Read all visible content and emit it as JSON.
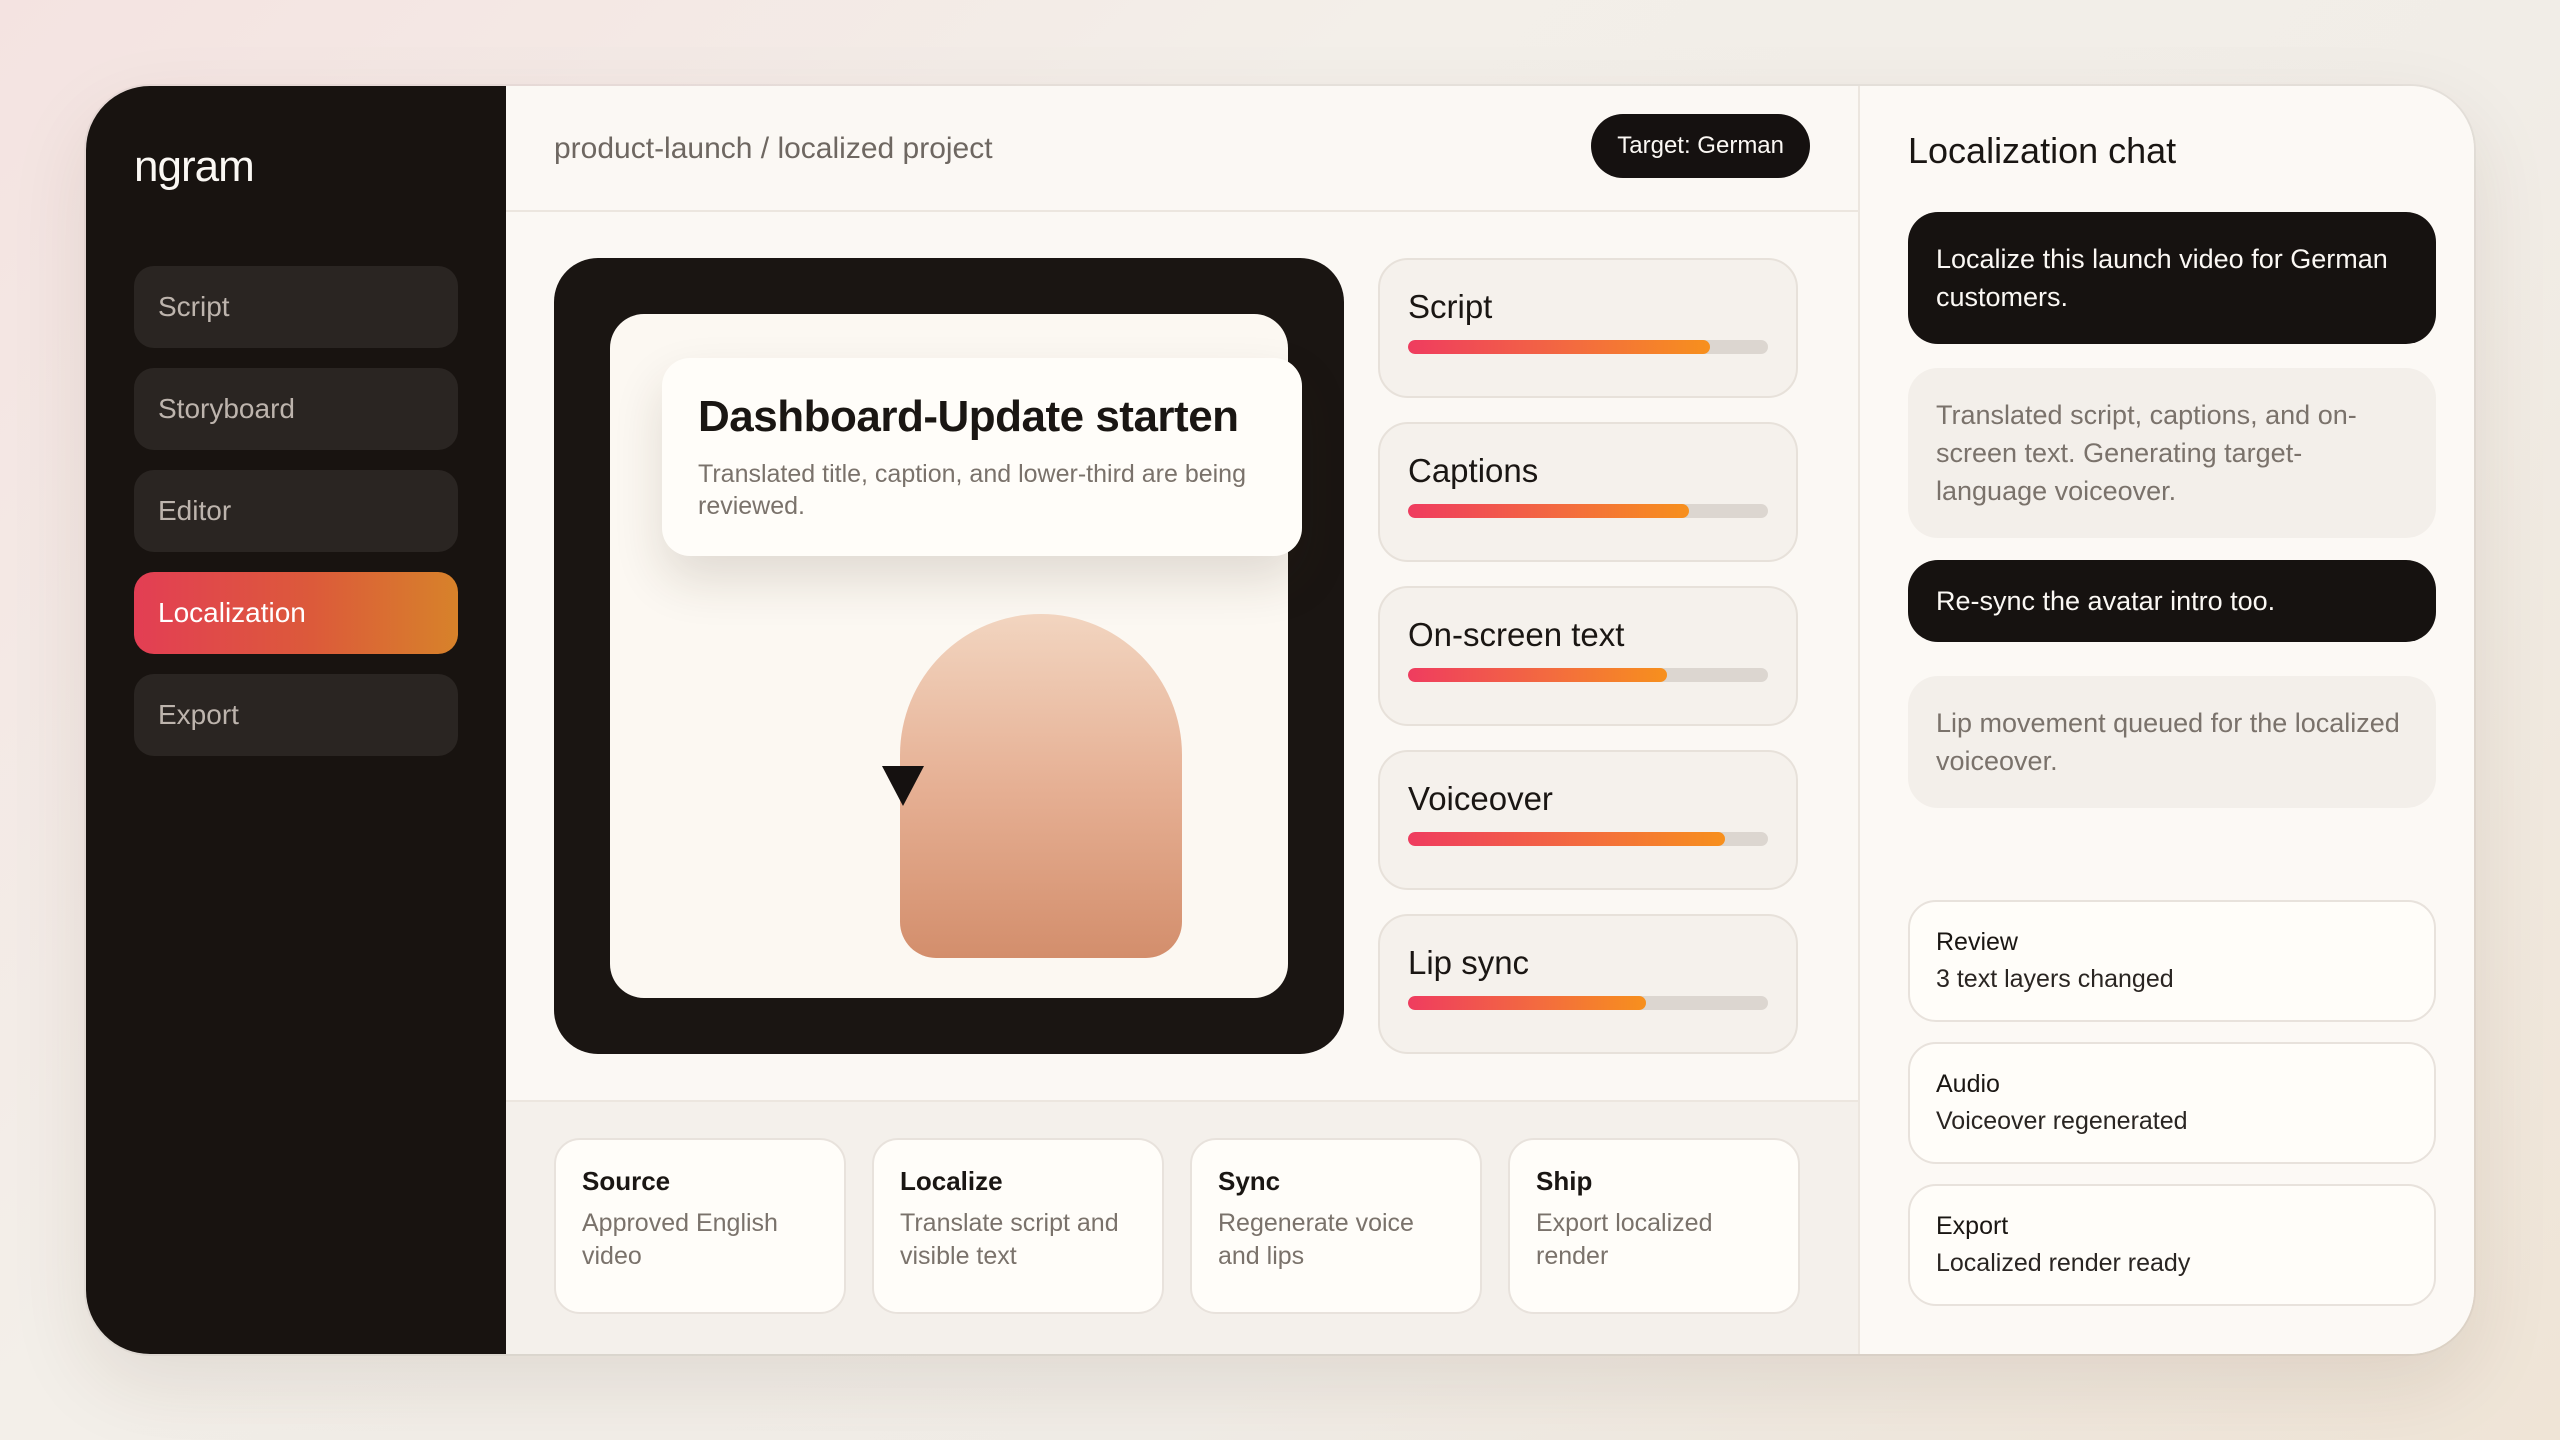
{
  "app": {
    "logo": "ngram"
  },
  "sidebar": {
    "items": [
      {
        "label": "Script",
        "active": false
      },
      {
        "label": "Storyboard",
        "active": false
      },
      {
        "label": "Editor",
        "active": false
      },
      {
        "label": "Localization",
        "active": true
      },
      {
        "label": "Export",
        "active": false
      }
    ]
  },
  "header": {
    "breadcrumb": "product-launch / localized project",
    "target_pill": "Target: German"
  },
  "preview": {
    "title": "Dashboard-Update starten",
    "subtitle": "Translated title, caption, and lower-third are being reviewed.",
    "cursor_icon": "play-cursor-icon"
  },
  "tracks": [
    {
      "label": "Script",
      "progress": 0.84
    },
    {
      "label": "Captions",
      "progress": 0.78
    },
    {
      "label": "On-screen text",
      "progress": 0.72
    },
    {
      "label": "Voiceover",
      "progress": 0.88
    },
    {
      "label": "Lip sync",
      "progress": 0.66
    }
  ],
  "steps": [
    {
      "title": "Source",
      "desc": "Approved English video"
    },
    {
      "title": "Localize",
      "desc": "Translate script and visible text"
    },
    {
      "title": "Sync",
      "desc": "Regenerate voice and lips"
    },
    {
      "title": "Ship",
      "desc": "Export localized render"
    }
  ],
  "chat": {
    "title": "Localization chat",
    "messages": [
      {
        "role": "user",
        "text": "Localize this launch video for German customers."
      },
      {
        "role": "bot",
        "text": "Translated script, captions, and on-screen text. Generating target-language voiceover."
      },
      {
        "role": "user",
        "text": "Re-sync the avatar intro too."
      },
      {
        "role": "bot",
        "text": "Lip movement queued for the localized voiceover."
      }
    ],
    "status_cards": [
      {
        "title": "Review",
        "desc": "3 text layers changed"
      },
      {
        "title": "Audio",
        "desc": "Voiceover regenerated"
      },
      {
        "title": "Export",
        "desc": "Localized render ready"
      }
    ]
  },
  "colors": {
    "accent_start": "#e33e54",
    "accent_end": "#d7822a",
    "dark": "#181310"
  }
}
